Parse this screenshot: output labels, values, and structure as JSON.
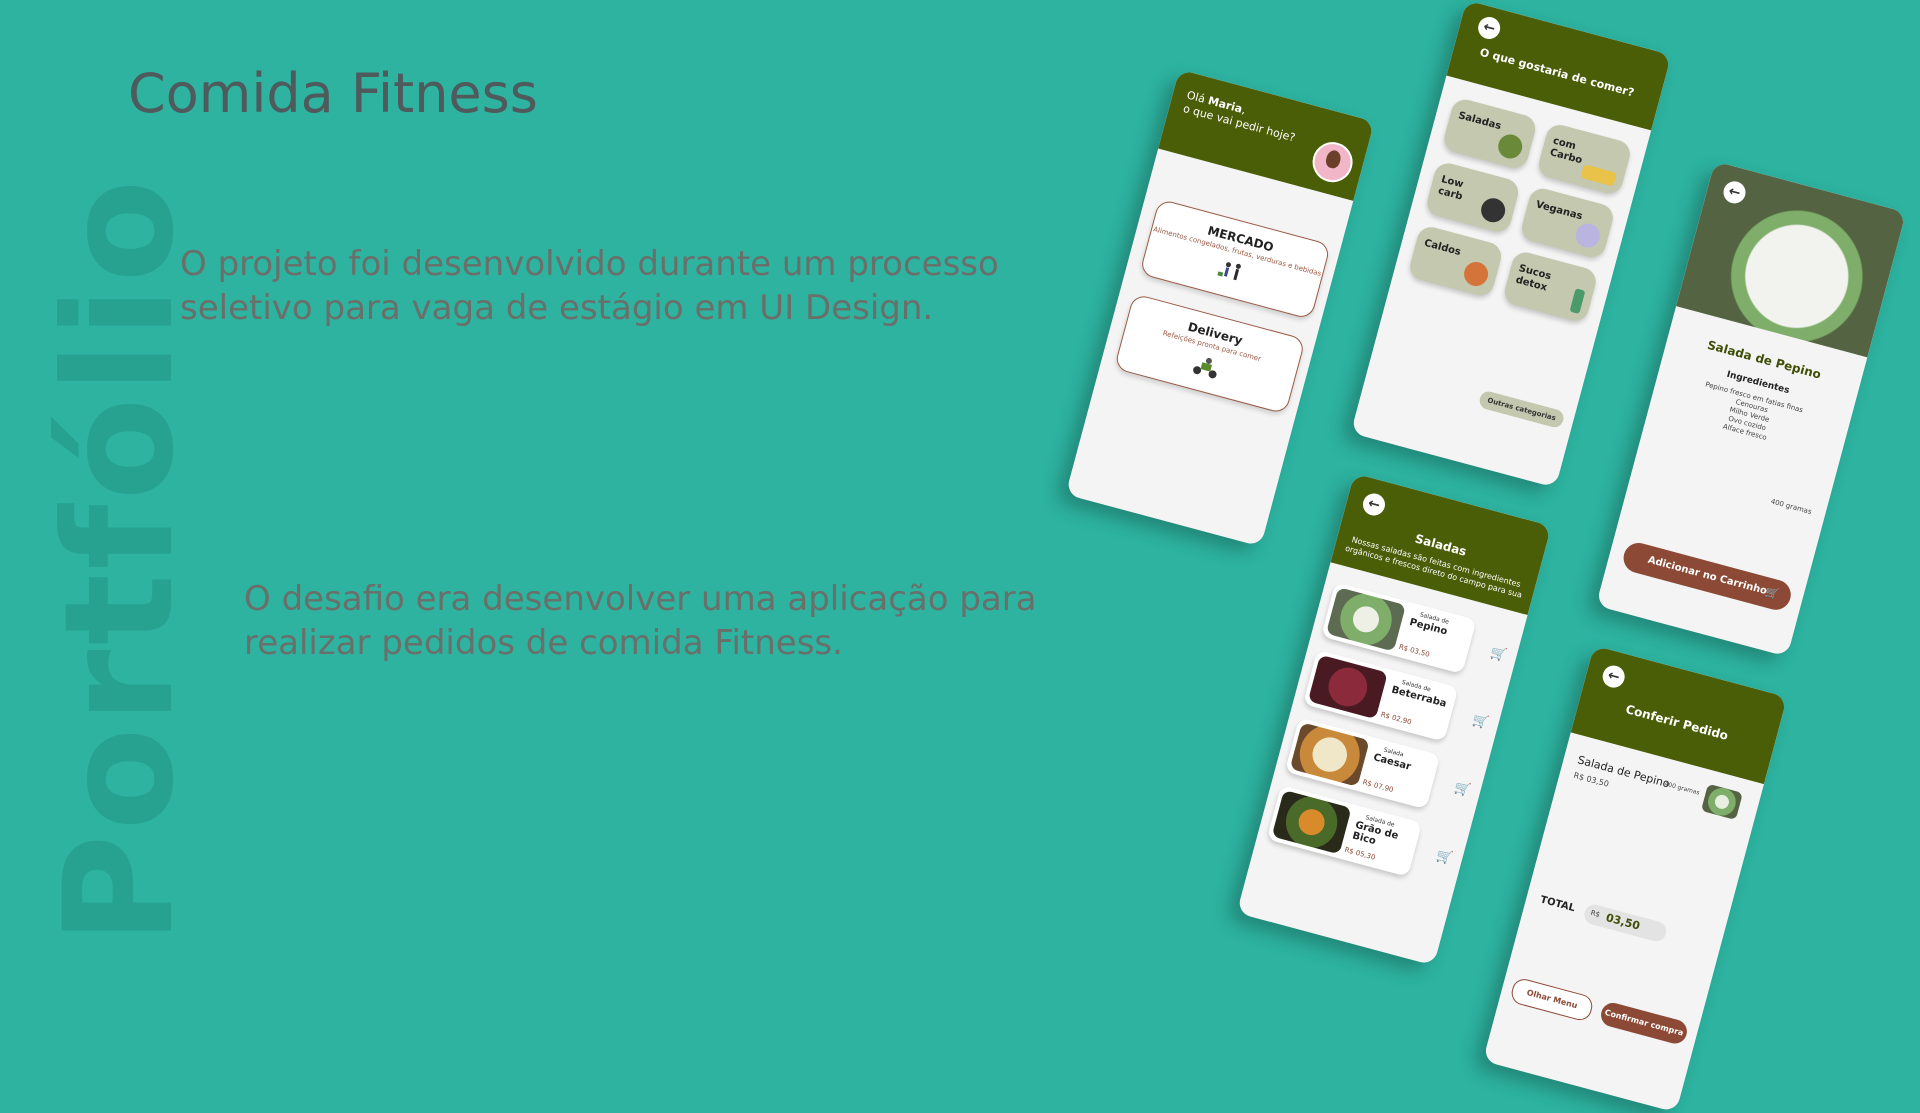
{
  "slide": {
    "watermark": "Portfólio",
    "title": "Comida Fitness",
    "paragraph1": "O projeto foi desenvolvido durante um processo seletivo para vaga de estágio em UI Design.",
    "paragraph2": "O desafio era desenvolver uma aplicação para realizar pedidos de comida Fitness."
  },
  "colors": {
    "background": "#2db3a0",
    "header_green": "#4a5d07",
    "accent_brown": "#8c4a36",
    "category_card": "#c3c8ae"
  },
  "home": {
    "greeting_prefix": "Olá",
    "user_name": "Maria",
    "greeting_question": "o que vai pedir hoje?",
    "options": [
      {
        "title": "MERCADO",
        "subtitle": "Alimentos congelados, frutas, verduras e bebidas",
        "icon": "shopping-people-icon"
      },
      {
        "title": "Delivery",
        "subtitle": "Refeições pronta para comer",
        "icon": "scooter-icon"
      }
    ]
  },
  "categories": {
    "back_icon": "arrow-left-icon",
    "title": "O que gostaria de comer?",
    "items": [
      {
        "label": "Saladas",
        "icon": "salad-bowl-icon"
      },
      {
        "label": "com Carbo",
        "icon": "pasta-dish-icon"
      },
      {
        "label": "Low carb",
        "icon": "pan-icon"
      },
      {
        "label": "Veganas",
        "icon": "vegan-plate-icon"
      },
      {
        "label": "Caldos",
        "icon": "soup-icon"
      },
      {
        "label": "Sucos detox",
        "icon": "juice-glass-icon"
      }
    ],
    "other_label": "Outras categorias"
  },
  "detail": {
    "back_icon": "arrow-left-icon",
    "name": "Salada de Pepino",
    "ingredients_label": "Ingredientes",
    "ingredients": [
      "Pepino fresco em fatias finas",
      "Cenouras",
      "Milho Verde",
      "Ovo cozido",
      "Alface fresco"
    ],
    "weight": "400 gramas",
    "add_button": "Adicionar no Carrinho",
    "cart_icon": "cart-icon"
  },
  "list": {
    "back_icon": "arrow-left-icon",
    "title": "Saladas",
    "description": "Nossas saladas são feitas com ingredientes orgânicos e frescos direto do campo para sua",
    "items": [
      {
        "type": "Salada de",
        "name": "Pepino",
        "price": "R$ 03,50"
      },
      {
        "type": "Salada de",
        "name": "Beterraba",
        "price": "R$ 02,90"
      },
      {
        "type": "Salada",
        "name": "Caesar",
        "price": "R$ 07,90"
      },
      {
        "type": "Salada de",
        "name": "Grão de Bico",
        "price": "R$ 05,30"
      }
    ]
  },
  "order": {
    "back_icon": "arrow-left-icon",
    "title": "Conferir Pedido",
    "item_name": "Salada de Pepino",
    "item_price": "R$ 03,50",
    "item_weight": "400 gramas",
    "total_label": "TOTAL",
    "total_currency": "R$",
    "total_value": "03,50",
    "menu_button": "Olhar Menu",
    "confirm_button": "Confirmar compra"
  }
}
